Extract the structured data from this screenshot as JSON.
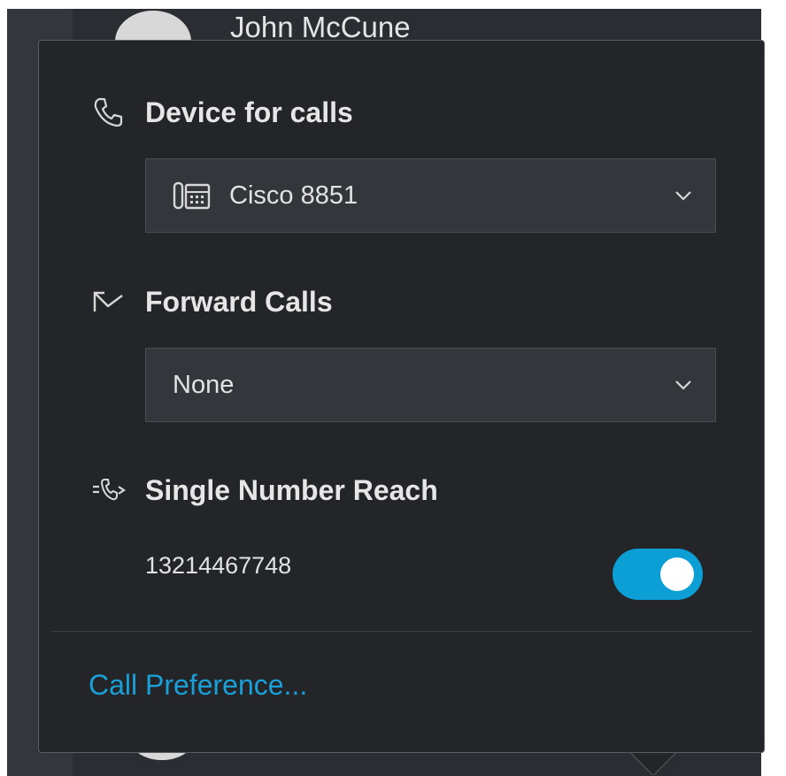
{
  "background": {
    "contact_name": "John McCune"
  },
  "popover": {
    "device_section": {
      "title": "Device for calls",
      "icon": "phone-handset-icon",
      "dropdown_value": "Cisco 8851",
      "dropdown_icon": "desk-phone-icon"
    },
    "forward_section": {
      "title": "Forward Calls",
      "icon": "forward-call-icon",
      "dropdown_value": "None"
    },
    "snr_section": {
      "title": "Single Number Reach",
      "icon": "single-number-reach-icon",
      "number": "13214467748",
      "enabled": true
    },
    "footer_link": "Call Preference..."
  },
  "colors": {
    "accent": "#0b9fd6",
    "link": "#1aa0d8",
    "panel": "#232528"
  }
}
